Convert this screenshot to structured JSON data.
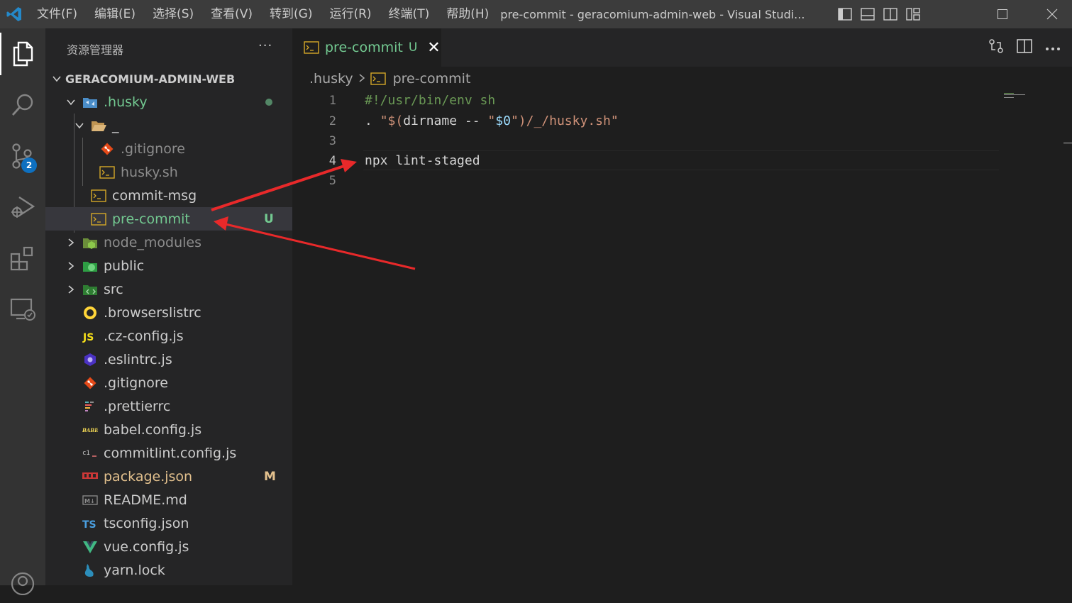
{
  "titlebar": {
    "menu": [
      "文件(F)",
      "编辑(E)",
      "选择(S)",
      "查看(V)",
      "转到(G)",
      "运行(R)",
      "终端(T)",
      "帮助(H)"
    ],
    "window_title": "pre-commit - geracomium-admin-web - Visual Studi..."
  },
  "activity_bar": {
    "items": [
      "explorer-icon",
      "search-icon",
      "source-control-icon",
      "run-debug-icon",
      "extensions-icon",
      "remote-explorer-icon",
      "account-icon"
    ],
    "source_control_badge": "2"
  },
  "sidebar": {
    "title": "资源管理器",
    "more": "···",
    "project": "GERACOMIUM-ADMIN-WEB",
    "items": [
      {
        "label": ".husky",
        "icon": "husky-folder-icon",
        "status": "dot"
      },
      {
        "label": "_",
        "icon": "folder-open-icon"
      },
      {
        "label": ".gitignore",
        "icon": "git-icon"
      },
      {
        "label": "husky.sh",
        "icon": "shell-icon"
      },
      {
        "label": "commit-msg",
        "icon": "shell-icon"
      },
      {
        "label": "pre-commit",
        "icon": "shell-icon",
        "status": "U"
      },
      {
        "label": "node_modules",
        "icon": "node-folder-icon"
      },
      {
        "label": "public",
        "icon": "public-folder-icon"
      },
      {
        "label": "src",
        "icon": "src-folder-icon"
      },
      {
        "label": ".browserslistrc",
        "icon": "browserslist-icon"
      },
      {
        "label": ".cz-config.js",
        "icon": "js-icon"
      },
      {
        "label": ".eslintrc.js",
        "icon": "eslint-icon"
      },
      {
        "label": ".gitignore",
        "icon": "git-icon"
      },
      {
        "label": ".prettierrc",
        "icon": "prettier-icon"
      },
      {
        "label": "babel.config.js",
        "icon": "babel-icon"
      },
      {
        "label": "commitlint.config.js",
        "icon": "commitlint-icon"
      },
      {
        "label": "package.json",
        "icon": "npm-icon",
        "status": "M"
      },
      {
        "label": "README.md",
        "icon": "markdown-icon"
      },
      {
        "label": "tsconfig.json",
        "icon": "typescript-icon"
      },
      {
        "label": "vue.config.js",
        "icon": "vue-icon"
      },
      {
        "label": "yarn.lock",
        "icon": "yarn-icon"
      }
    ]
  },
  "editor": {
    "tab": {
      "label": "pre-commit",
      "status": "U",
      "close": "✕"
    },
    "breadcrumbs": [
      ".husky",
      "pre-commit"
    ],
    "lines": [
      {
        "num": "1",
        "text": "#!/usr/bin/env sh"
      },
      {
        "num": "2",
        "text": ". \"$(dirname -- \"$0\")/_/husky.sh\""
      },
      {
        "num": "3",
        "text": ""
      },
      {
        "num": "4",
        "text": "npx lint-staged"
      },
      {
        "num": "5",
        "text": ""
      }
    ]
  },
  "colors": {
    "untracked": "#73c991",
    "modified": "#e2c08d",
    "annotation_arrow": "#e8292a"
  }
}
